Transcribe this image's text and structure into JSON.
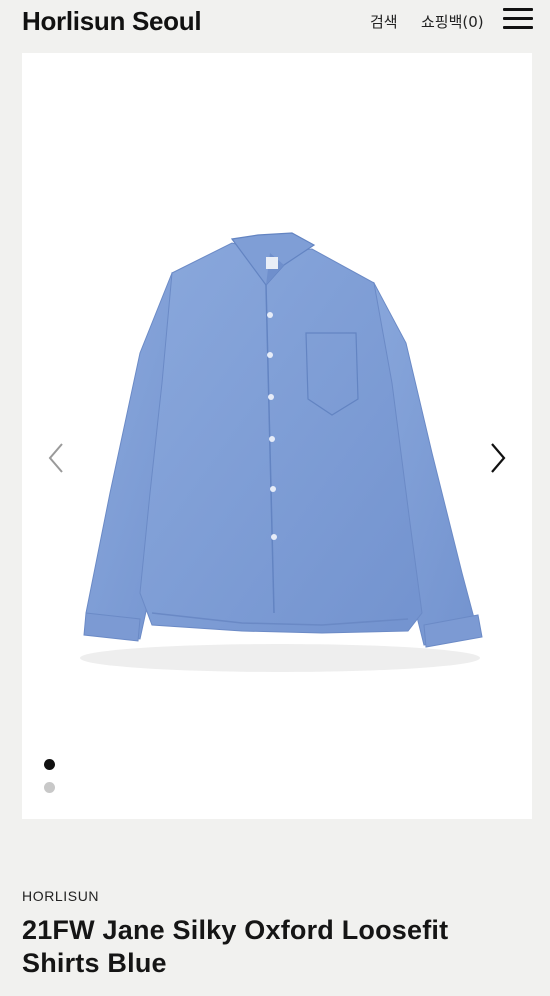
{
  "header": {
    "brand": "Horlisun Seoul",
    "search_label": "검색",
    "bag_label": "쇼핑백(0)",
    "menu_icon": "hamburger-menu-icon"
  },
  "carousel": {
    "image_alt": "21FW Jane Silky Oxford Loosefit Shirts Blue",
    "prev_icon": "chevron-left-icon",
    "next_icon": "chevron-right-icon",
    "slide_count": 2,
    "active_slide": 1,
    "colors": {
      "shirt": "#7f9fd6",
      "shirt_shadow": "#5f7fbf",
      "active_dot": "#111111",
      "inactive_dot": "#c8c8c8"
    }
  },
  "product": {
    "brand": "HORLISUN",
    "title": "21FW Jane Silky Oxford Loosefit Shirts Blue"
  }
}
